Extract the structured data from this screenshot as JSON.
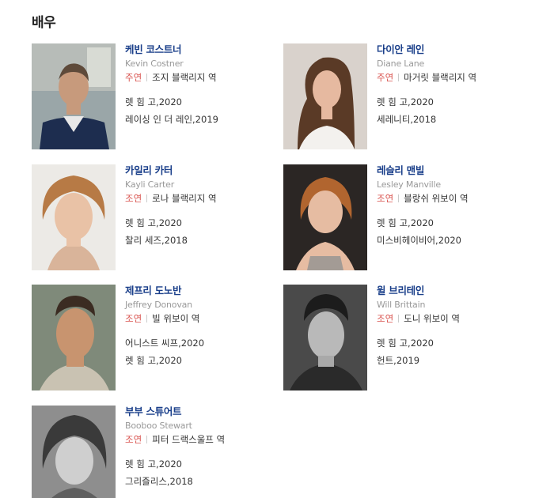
{
  "section_title": "배우",
  "actors": [
    {
      "name_ko": "케빈 코스트너",
      "name_en": "Kevin Costner",
      "role_type": "주연",
      "role": "조지 블랙리지 역",
      "works": [
        "렛 힘 고,2020",
        "레이싱 인 더 레인,2019"
      ],
      "photo_icon": "actor-photo-kevin-costner"
    },
    {
      "name_ko": "다이안 레인",
      "name_en": "Diane Lane",
      "role_type": "주연",
      "role": "마거릿 블랙리지 역",
      "works": [
        "렛 힘 고,2020",
        "세레니티,2018"
      ],
      "photo_icon": "actor-photo-diane-lane"
    },
    {
      "name_ko": "카일리 카터",
      "name_en": "Kayli Carter",
      "role_type": "조연",
      "role": "로나 블랙리지 역",
      "works": [
        "렛 힘 고,2020",
        "찰리 세즈,2018"
      ],
      "photo_icon": "actor-photo-kayli-carter"
    },
    {
      "name_ko": "레슬리 맨빌",
      "name_en": "Lesley Manville",
      "role_type": "조연",
      "role": "블랑쉬 위보이 역",
      "works": [
        "렛 힘 고,2020",
        "미스비헤이비어,2020"
      ],
      "photo_icon": "actor-photo-lesley-manville"
    },
    {
      "name_ko": "제프리 도노반",
      "name_en": "Jeffrey Donovan",
      "role_type": "조연",
      "role": "빌 위보이 역",
      "works": [
        "어니스트 씨프,2020",
        "렛 힘 고,2020"
      ],
      "photo_icon": "actor-photo-jeffrey-donovan"
    },
    {
      "name_ko": "윌 브리테인",
      "name_en": "Will Brittain",
      "role_type": "조연",
      "role": "도니 위보이 역",
      "works": [
        "렛 힘 고,2020",
        "헌트,2019"
      ],
      "photo_icon": "actor-photo-will-brittain"
    },
    {
      "name_ko": "부부 스튜어트",
      "name_en": "Booboo Stewart",
      "role_type": "조연",
      "role": "피터 드랙스울프 역",
      "works": [
        "렛 힘 고,2020",
        "그리즐리스,2018"
      ],
      "photo_icon": "actor-photo-booboo-stewart"
    }
  ]
}
